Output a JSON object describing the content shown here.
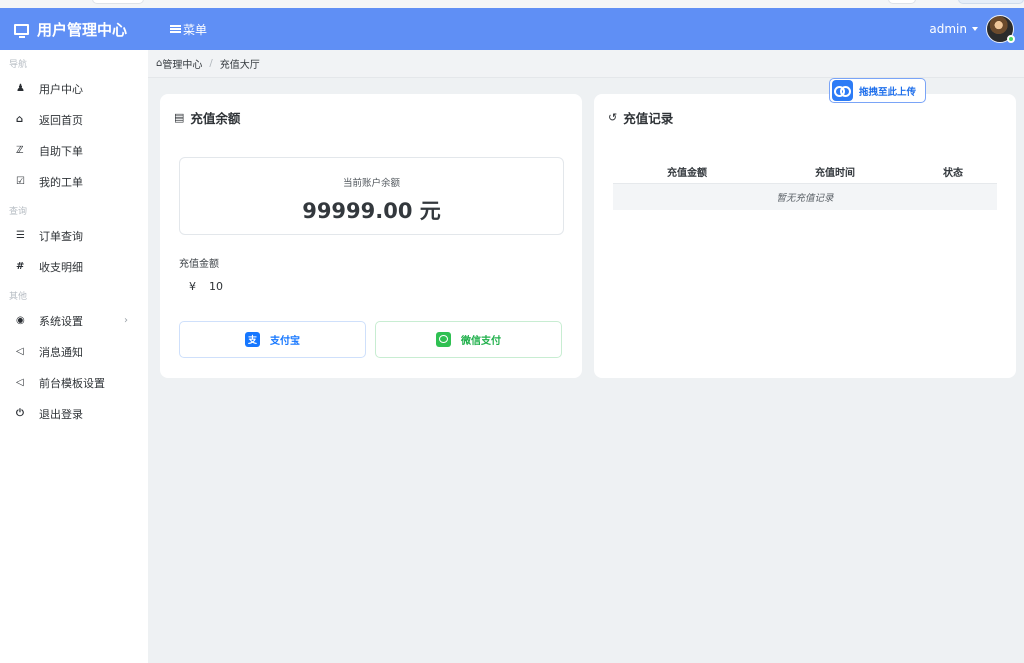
{
  "header": {
    "brand": "用户管理中心",
    "menu_label": "菜单",
    "username": "admin"
  },
  "sidebar": {
    "sections": [
      {
        "title": "导航",
        "items": [
          {
            "icon": "user-icon",
            "glyph": "♟",
            "label": "用户中心"
          },
          {
            "icon": "home-icon",
            "glyph": "⌂",
            "label": "返回首页"
          },
          {
            "icon": "cart-icon",
            "glyph": "🛒",
            "label": "自助下单"
          },
          {
            "icon": "ticket-icon",
            "glyph": "☑",
            "label": "我的工单"
          }
        ]
      },
      {
        "title": "查询",
        "items": [
          {
            "icon": "list-icon",
            "glyph": "☰",
            "label": "订单查询"
          },
          {
            "icon": "hash-icon",
            "glyph": "#",
            "label": "收支明细"
          }
        ]
      },
      {
        "title": "其他",
        "items": [
          {
            "icon": "settings-icon",
            "glyph": "⏻",
            "label": "系统设置",
            "chevron": "›"
          },
          {
            "icon": "megaphone-icon",
            "glyph": "📢",
            "label": "消息通知"
          },
          {
            "icon": "megaphone-icon",
            "glyph": "📢",
            "label": "前台模板设置"
          },
          {
            "icon": "power-icon",
            "glyph": "⏻",
            "label": "退出登录"
          }
        ]
      }
    ]
  },
  "breadcrumb": {
    "home": "管理中心",
    "separator": "/",
    "current": "充值大厅"
  },
  "recharge": {
    "title": "充值余额",
    "balance_label": "当前账户余额",
    "balance_value": "99999.00 元",
    "amount_label": "充值金额",
    "currency": "¥",
    "amount_value": "10",
    "alipay_label": "支付宝",
    "wechat_label": "微信支付"
  },
  "records": {
    "title": "充值记录",
    "columns": [
      "充值金额",
      "充值时间",
      "状态"
    ],
    "empty_text": "暂无充值记录"
  },
  "upload_badge": "拖拽至此上传",
  "colors": {
    "navbar": "#5f8ff5",
    "alipay": "#1677ff",
    "wechat": "#2fc052",
    "background": "#eef1f3"
  }
}
